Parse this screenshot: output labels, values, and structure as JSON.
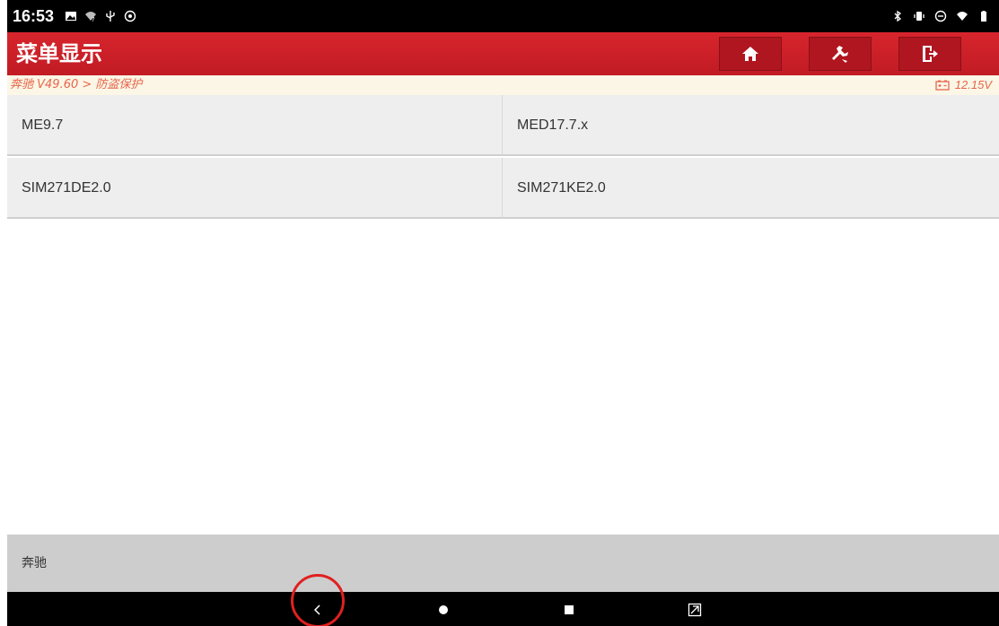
{
  "status_bar": {
    "time": "16:53",
    "left_icons": [
      "image-icon",
      "wifi-question-icon",
      "usb-icon",
      "settings-circle-icon"
    ],
    "right_icons": [
      "bluetooth-icon",
      "vibrate-icon",
      "dnd-icon",
      "wifi-icon",
      "battery-icon"
    ]
  },
  "header": {
    "title": "菜单显示",
    "buttons": [
      "home-icon",
      "diagnose-icon",
      "exit-icon"
    ]
  },
  "breadcrumb": {
    "path": "奔驰 V49.60 > 防盗保护",
    "voltage": "12.15V"
  },
  "menu": {
    "items": [
      {
        "label": "ME9.7"
      },
      {
        "label": "MED17.7.x"
      },
      {
        "label": "SIM271DE2.0"
      },
      {
        "label": "SIM271KE2.0"
      }
    ]
  },
  "footer": {
    "label": "奔驰"
  },
  "nav": {
    "buttons": [
      "back-icon",
      "home-dot-icon",
      "recents-icon",
      "screenshot-icon"
    ]
  },
  "colors": {
    "header_red": "#c8202a",
    "breadcrumb_orange": "#e8664b",
    "menu_bg": "#eeeeee",
    "footer_bg": "#cdcdcd",
    "highlight_circle": "#e02020"
  }
}
